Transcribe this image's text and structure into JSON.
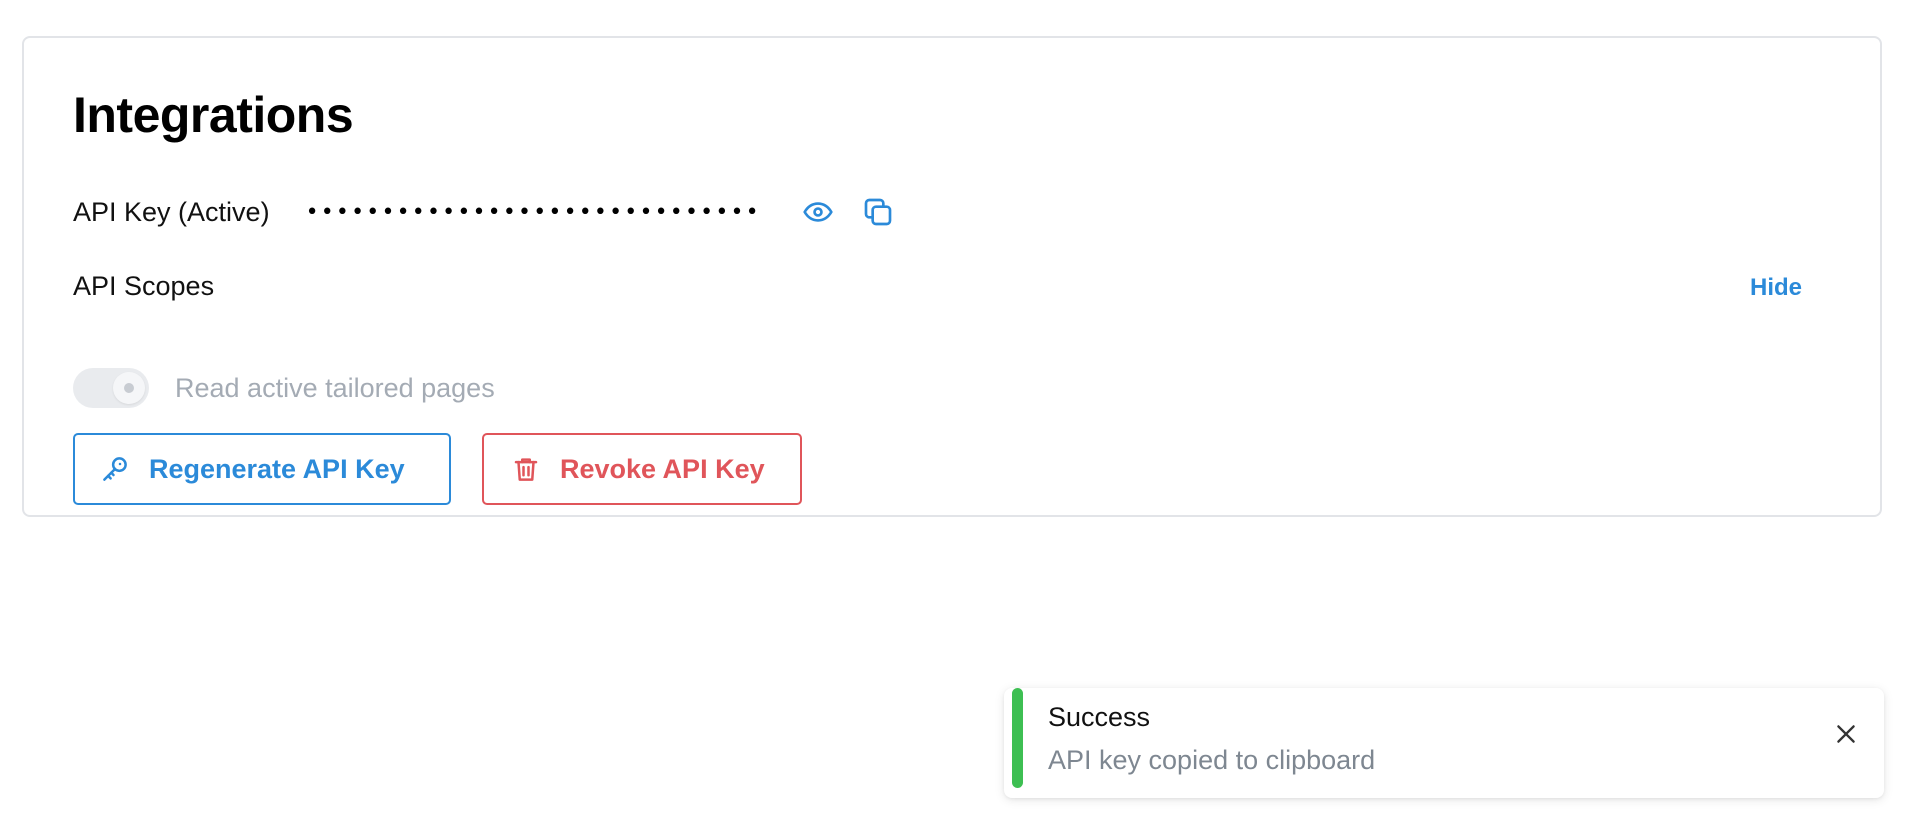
{
  "integrations": {
    "title": "Integrations",
    "api_key": {
      "label": "API Key (Active)",
      "masked_value": "••••••••••••••••••••••••••••••",
      "show_icon": "eye-icon",
      "copy_icon": "copy-icon"
    },
    "scopes": {
      "label": "API Scopes",
      "toggle_link": "Hide",
      "items": [
        {
          "label": "Read active tailored pages",
          "enabled": true,
          "disabled": true
        }
      ]
    },
    "actions": {
      "regenerate_label": "Regenerate API Key",
      "regenerate_icon": "key-icon",
      "revoke_label": "Revoke API Key",
      "revoke_icon": "trash-icon"
    }
  },
  "toast": {
    "title": "Success",
    "message": "API key copied to clipboard",
    "close_icon": "close-icon"
  },
  "colors": {
    "accent": "#2b8ad9",
    "danger": "#e0555a",
    "success": "#3dbf52",
    "muted_text": "#a4abb4",
    "border": "#e2e4e8"
  }
}
